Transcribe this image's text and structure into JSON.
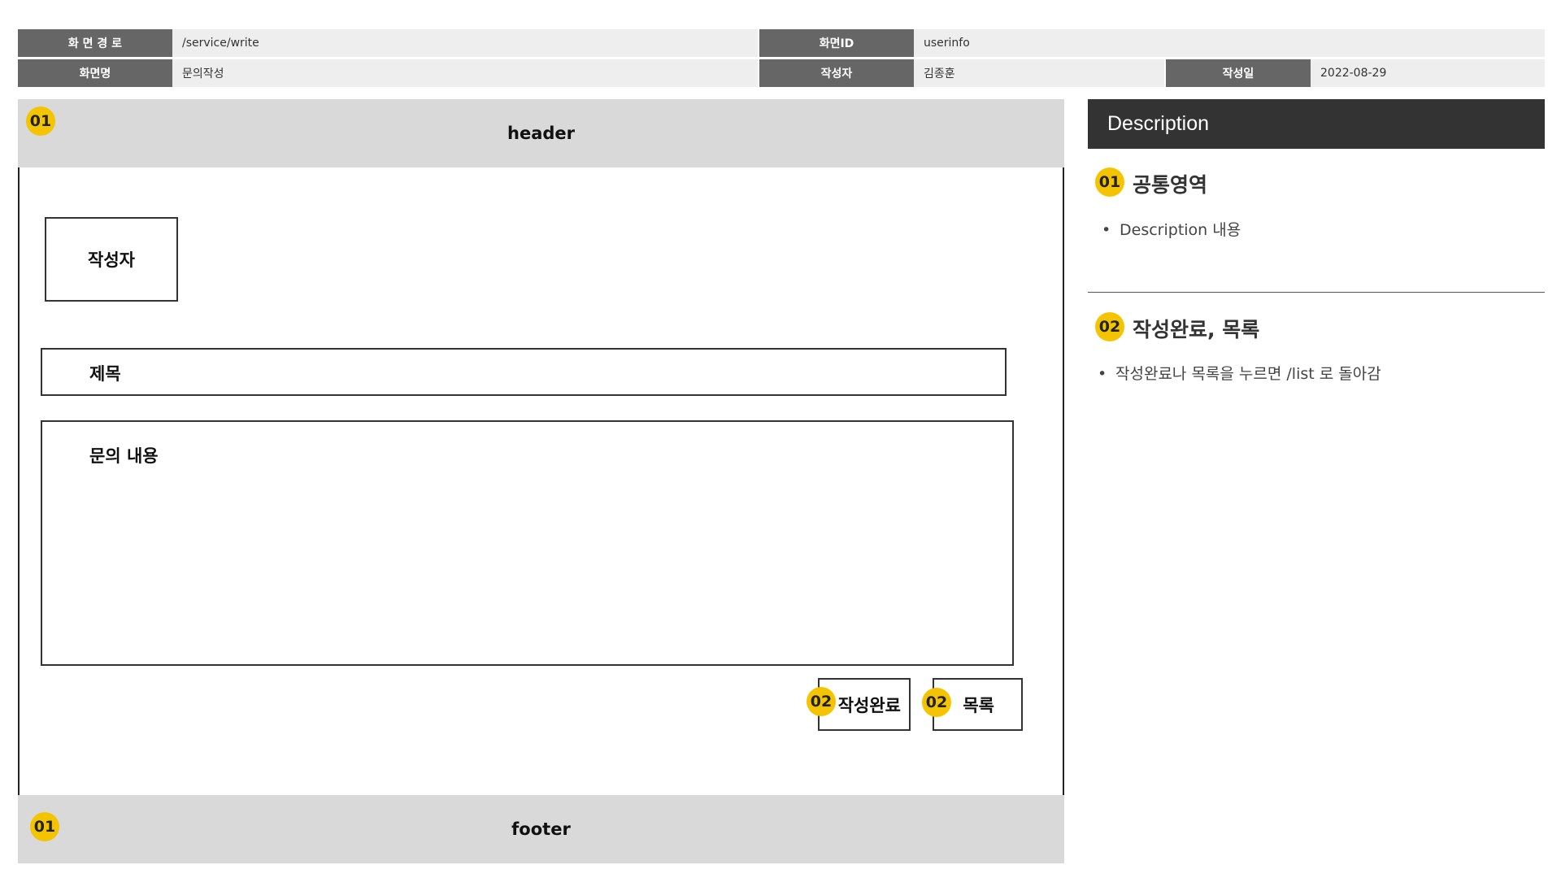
{
  "info": {
    "path_label": "화 면 경 로",
    "path_value": "/service/write",
    "screen_id_label": "화면ID",
    "screen_id_value": "userinfo",
    "screen_name_label": "화면명",
    "screen_name_value": "문의작성",
    "author_label": "작성자",
    "author_value": "김종훈",
    "date_label": "작성일",
    "date_value": "2022-08-29"
  },
  "wireframe": {
    "header_text": "header",
    "footer_text": "footer",
    "author_box": "작성자",
    "title_box": "제목",
    "content_box": "문의 내용",
    "submit_button": "작성완료",
    "list_button": "목록",
    "badge_header": "01",
    "badge_footer": "01",
    "badge_submit": "02",
    "badge_list": "02"
  },
  "description": {
    "title": "Description",
    "sections": [
      {
        "badge": "01",
        "heading": "공통영역",
        "bullet": "Description 내용"
      },
      {
        "badge": "02",
        "heading": "작성완료, 목록",
        "bullet": "작성완료나 목록을 누르면 /list 로 돌아감"
      }
    ]
  },
  "colors": {
    "label_bg": "#666666",
    "value_bg": "#eeeeee",
    "band_bg": "#d9d9d9",
    "badge": "#f5c400",
    "desc_header_bg": "#333333"
  }
}
